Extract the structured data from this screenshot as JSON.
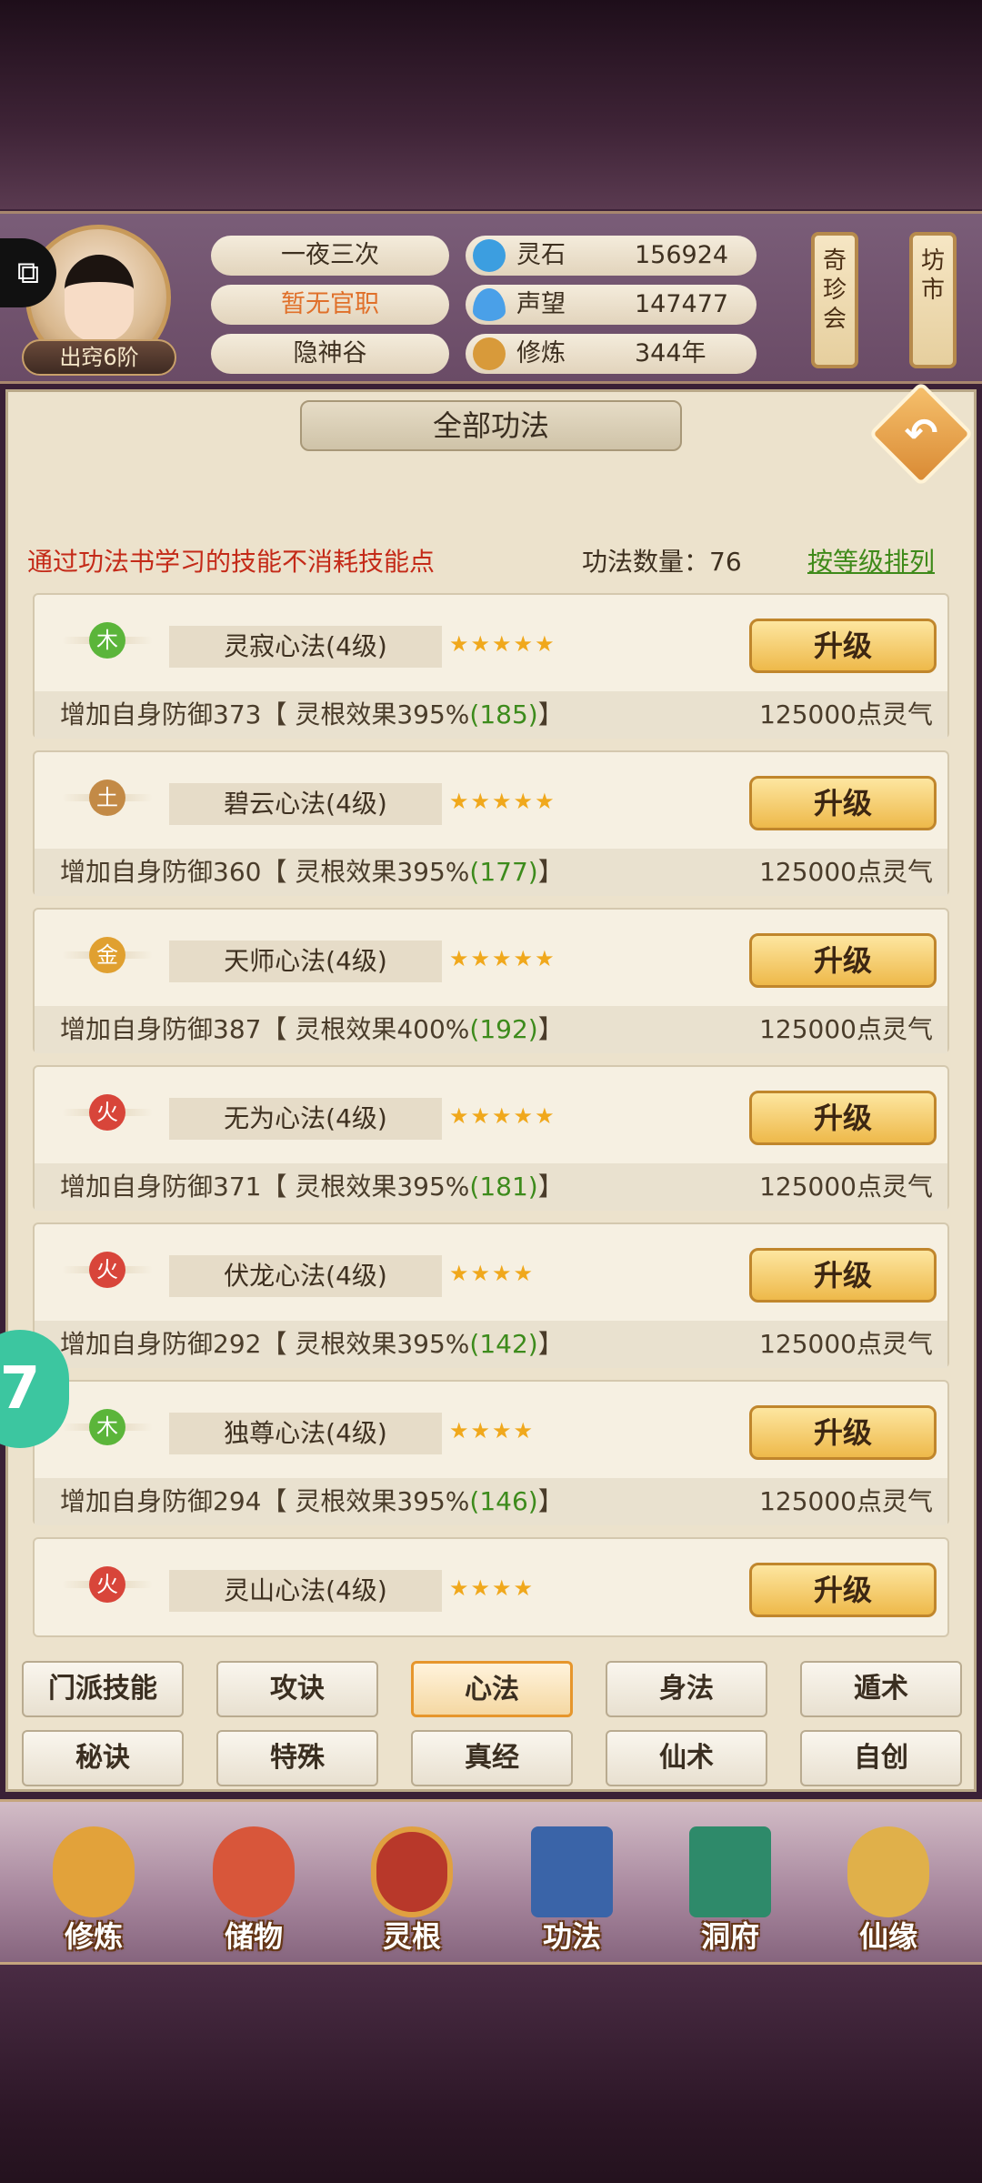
{
  "header": {
    "rank": "出窍6阶",
    "player_name": "一夜三次",
    "official_title": "暂无官职",
    "sect": "隐神谷",
    "resources": [
      {
        "label": "灵石",
        "value": "156924",
        "icon": "spirit-stone-icon",
        "color": "#3c9ee0"
      },
      {
        "label": "声望",
        "value": "147477",
        "icon": "reputation-icon",
        "color": "#4aa0e8"
      },
      {
        "label": "修炼",
        "value": "344年",
        "icon": "meditation-icon",
        "color": "#d89a3a"
      }
    ],
    "scroll_buttons": [
      "奇珍会",
      "坊市"
    ]
  },
  "panel": {
    "title": "全部功法",
    "notice": "通过功法书学习的技能不消耗技能点",
    "count_label": "功法数量：76",
    "sort_label": "按等级排列"
  },
  "skills": [
    {
      "element": "木",
      "name": "灵寂心法(4级)",
      "stars": "★★★★★",
      "button": "升级",
      "desc_prefix": "增加自身防御373【 灵根效果395%",
      "desc_bonus": "(185)",
      "desc_suffix": "】",
      "cost": "125000点灵气"
    },
    {
      "element": "土",
      "name": "碧云心法(4级)",
      "stars": "★★★★★",
      "button": "升级",
      "desc_prefix": "增加自身防御360【 灵根效果395%",
      "desc_bonus": "(177)",
      "desc_suffix": "】",
      "cost": "125000点灵气"
    },
    {
      "element": "金",
      "name": "天师心法(4级)",
      "stars": "★★★★★",
      "button": "升级",
      "desc_prefix": "增加自身防御387【 灵根效果400%",
      "desc_bonus": "(192)",
      "desc_suffix": "】",
      "cost": "125000点灵气"
    },
    {
      "element": "火",
      "name": "无为心法(4级)",
      "stars": "★★★★★",
      "button": "升级",
      "desc_prefix": "增加自身防御371【 灵根效果395%",
      "desc_bonus": "(181)",
      "desc_suffix": "】",
      "cost": "125000点灵气"
    },
    {
      "element": "火",
      "name": "伏龙心法(4级)",
      "stars": "★★★★",
      "button": "升级",
      "desc_prefix": "增加自身防御292【 灵根效果395%",
      "desc_bonus": "(142)",
      "desc_suffix": "】",
      "cost": "125000点灵气"
    },
    {
      "element": "木",
      "name": "独尊心法(4级)",
      "stars": "★★★★",
      "button": "升级",
      "desc_prefix": "增加自身防御294【 灵根效果395%",
      "desc_bonus": "(146)",
      "desc_suffix": "】",
      "cost": "125000点灵气"
    },
    {
      "element": "火",
      "name": "灵山心法(4级)",
      "stars": "★★★★",
      "button": "升级"
    }
  ],
  "element_colors": {
    "木": "#5bb53a",
    "土": "#c38a46",
    "金": "#e0a030",
    "火": "#d8453a"
  },
  "float_ball": "7",
  "tabs_row1": [
    "门派技能",
    "攻诀",
    "心法",
    "身法",
    "遁术"
  ],
  "tabs_row2": [
    "秘诀",
    "特殊",
    "真经",
    "仙术",
    "自创"
  ],
  "active_tab": "心法",
  "bottom_nav": [
    {
      "label": "修炼",
      "icon": "cultivation-icon",
      "color": "#e2a23a"
    },
    {
      "label": "储物",
      "icon": "storage-bag-icon",
      "color": "#d8563a"
    },
    {
      "label": "灵根",
      "icon": "spirit-root-icon",
      "color": "#b8382a"
    },
    {
      "label": "功法",
      "icon": "skill-book-icon",
      "color": "#3a64a8"
    },
    {
      "label": "洞府",
      "icon": "cave-house-icon",
      "color": "#2e8a6a"
    },
    {
      "label": "仙缘",
      "icon": "fate-gourd-icon",
      "color": "#e0b04a"
    }
  ]
}
